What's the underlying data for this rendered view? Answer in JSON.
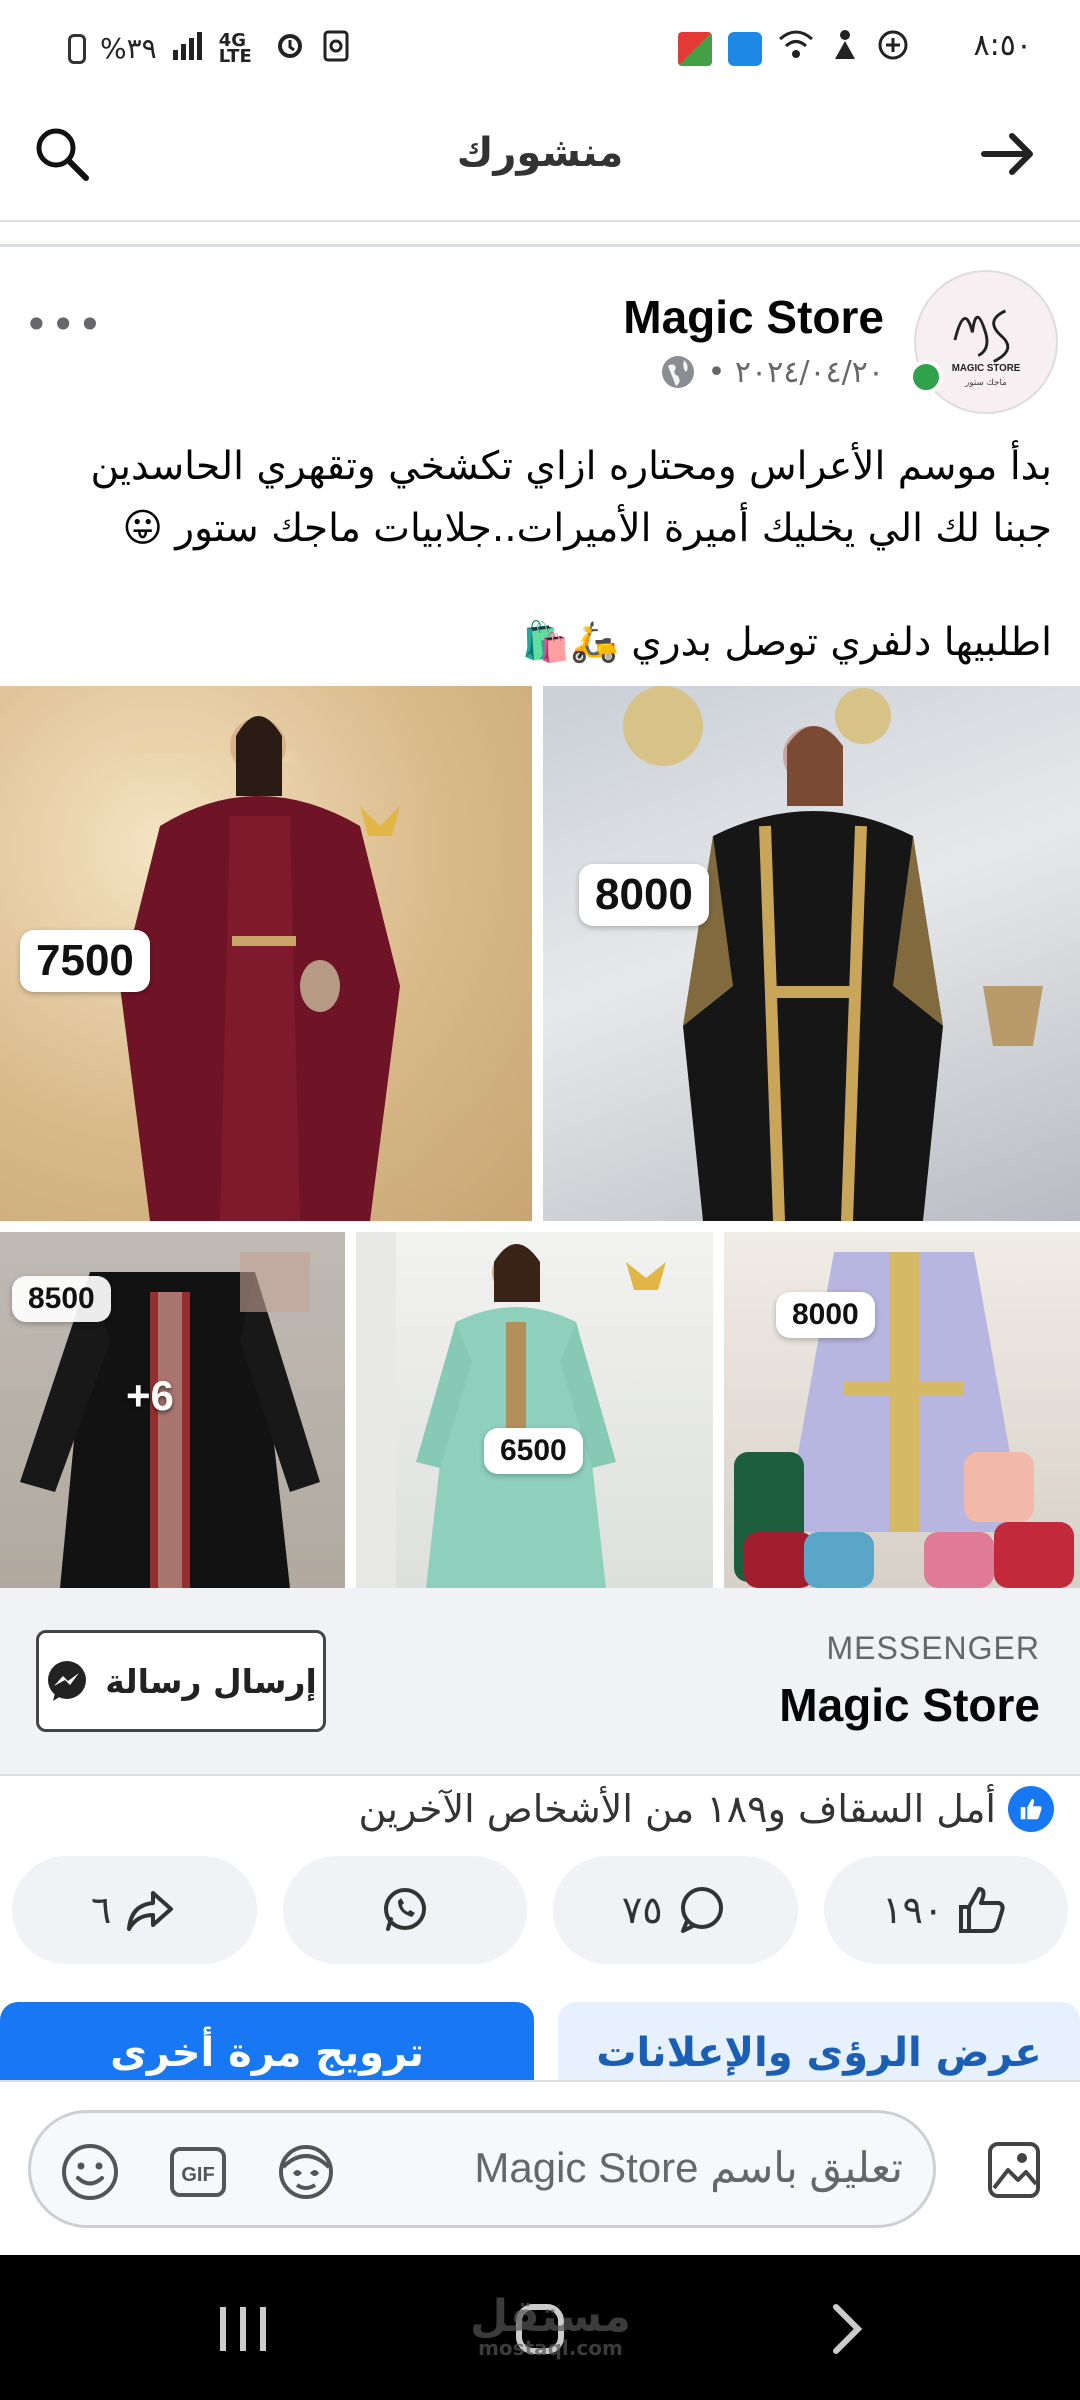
{
  "status_bar": {
    "time": "٨:٥٠",
    "battery": "%٣٩",
    "network": "4G LTE"
  },
  "header": {
    "title": "منشورك"
  },
  "post": {
    "author": "Magic Store",
    "date": "٢٠٢٤/٠٤/٢٠ •",
    "caption_line1": "بدأ موسم الأعراس ومحتاره ازاي تكشخي وتقهري الحاسدين",
    "caption_line2": "جبنا لك الي يخليك أميرة الأميرات..جلابيات ماجك ستور 😛",
    "caption_line3": "اطلبيها دلفري توصل بدري 🛵🛍️",
    "avatar_text": "MAGIC STORE",
    "avatar_subtext": "ماجك ستور"
  },
  "photos": {
    "p1_price": "7500",
    "p2_price": "8000",
    "p3_price": "8500",
    "p3_more": "+6",
    "p4_price": "6500",
    "p5_price": "8000"
  },
  "messenger": {
    "label": "MESSENGER",
    "name": "Magic Store",
    "send_button": "إرسال رسالة"
  },
  "reactions": {
    "summary": "أمل السقاف و١٨٩ من الأشخاص الآخرين"
  },
  "actions": {
    "likes": "١٩٠",
    "comments": "٧٥",
    "shares": "٦"
  },
  "promo": {
    "boost_again": "ترويج مرة أخرى",
    "view_insights": "عرض الرؤى والإعلانات"
  },
  "comment_bar": {
    "placeholder": "تعليق باسم Magic Store"
  },
  "watermark": {
    "text": "مستقل",
    "domain": "mostaql.com"
  },
  "colors": {
    "facebook_blue": "#1877f2",
    "online_green": "#31a24c"
  }
}
